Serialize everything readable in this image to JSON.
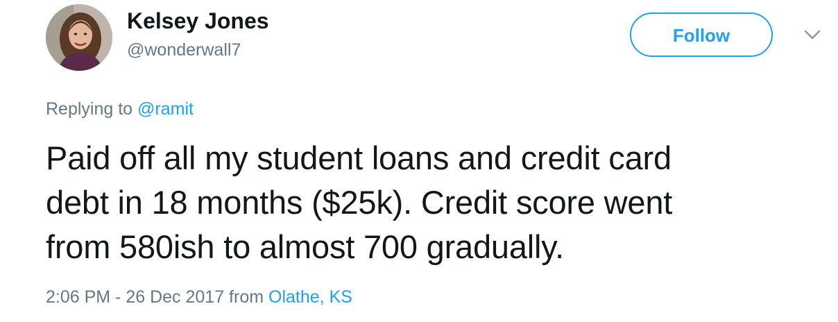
{
  "author": {
    "display_name": "Kelsey Jones",
    "handle": "@wonderwall7"
  },
  "actions": {
    "follow_label": "Follow",
    "menu_icon": "chevron-down-icon"
  },
  "reply": {
    "prefix": "Replying to",
    "mention": "@ramit"
  },
  "tweet": {
    "lines": [
      "Paid off all my student loans and credit card",
      "debt in 18 months ($25k). Credit score went",
      "from 580ish to almost 700 gradually."
    ]
  },
  "meta": {
    "timestamp": "2:06 PM - 26 Dec 2017",
    "from_label": "from",
    "location": "Olathe, KS"
  },
  "colors": {
    "accent": "#1da1f2",
    "text": "#14171a",
    "muted": "#657786"
  }
}
